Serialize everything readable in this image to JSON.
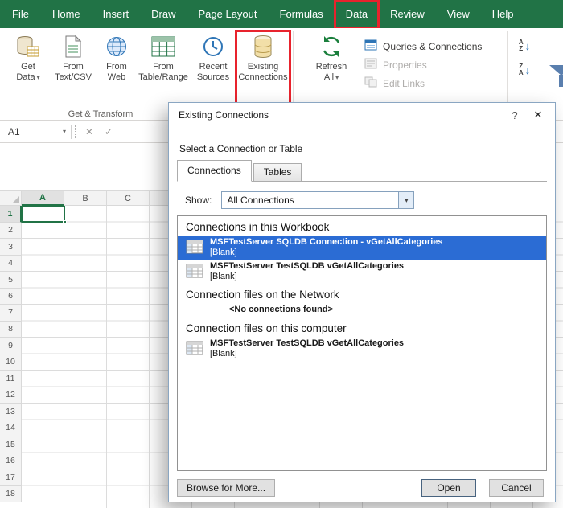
{
  "colors": {
    "excel_green": "#217346",
    "annotation_red": "#e8232d",
    "selection_blue": "#2b6cd4"
  },
  "tab_bar": {
    "tabs": [
      "File",
      "Home",
      "Insert",
      "Draw",
      "Page Layout",
      "Formulas",
      "Data",
      "Review",
      "View",
      "Help"
    ],
    "active_tab": "Data"
  },
  "ribbon": {
    "group_label": "Get & Transform",
    "buttons": {
      "get_data": "Get Data",
      "from_text_csv": "From Text/CSV",
      "from_web": "From Web",
      "from_table_range": "From Table/Range",
      "recent_sources": "Recent Sources",
      "existing_connections": "Existing Connections",
      "refresh_all": "Refresh All",
      "queries_connections": "Queries & Connections",
      "properties": "Properties",
      "edit_links": "Edit Links"
    }
  },
  "formula_bar": {
    "name_box": "A1"
  },
  "grid": {
    "columns": [
      "A",
      "B",
      "C"
    ],
    "rows": [
      "1",
      "2",
      "3",
      "4",
      "5",
      "6",
      "7",
      "8",
      "9",
      "10",
      "11",
      "12",
      "13",
      "14",
      "15",
      "16",
      "17",
      "18"
    ],
    "selected_cell": "A1"
  },
  "glyphs": {
    "caret": "▾",
    "close": "✕",
    "check": "✓",
    "help": "?",
    "sort_a": "A",
    "sort_z": "Z",
    "arrow_down": "↓"
  },
  "dialog": {
    "title": "Existing Connections",
    "subtitle": "Select a Connection or Table",
    "tabs": [
      {
        "label": "Connections",
        "active": true
      },
      {
        "label": "Tables",
        "active": false
      }
    ],
    "show_label": "Show:",
    "show_value": "All Connections",
    "list": {
      "groups": [
        {
          "header": "Connections in this Workbook",
          "items": [
            {
              "name": "MSFTestServer SQLDB Connection - vGetAllCategories",
              "description": "[Blank]",
              "selected": true
            },
            {
              "name": "MSFTestServer TestSQLDB vGetAllCategories",
              "description": "[Blank]",
              "selected": false
            }
          ]
        },
        {
          "header": "Connection files on the Network",
          "empty_text": "<No connections found>",
          "items": []
        },
        {
          "header": "Connection files on this computer",
          "items": [
            {
              "name": "MSFTestServer TestSQLDB vGetAllCategories",
              "description": "[Blank]",
              "selected": false
            }
          ]
        }
      ]
    },
    "buttons": {
      "browse": "Browse for More...",
      "open": "Open",
      "cancel": "Cancel"
    }
  }
}
